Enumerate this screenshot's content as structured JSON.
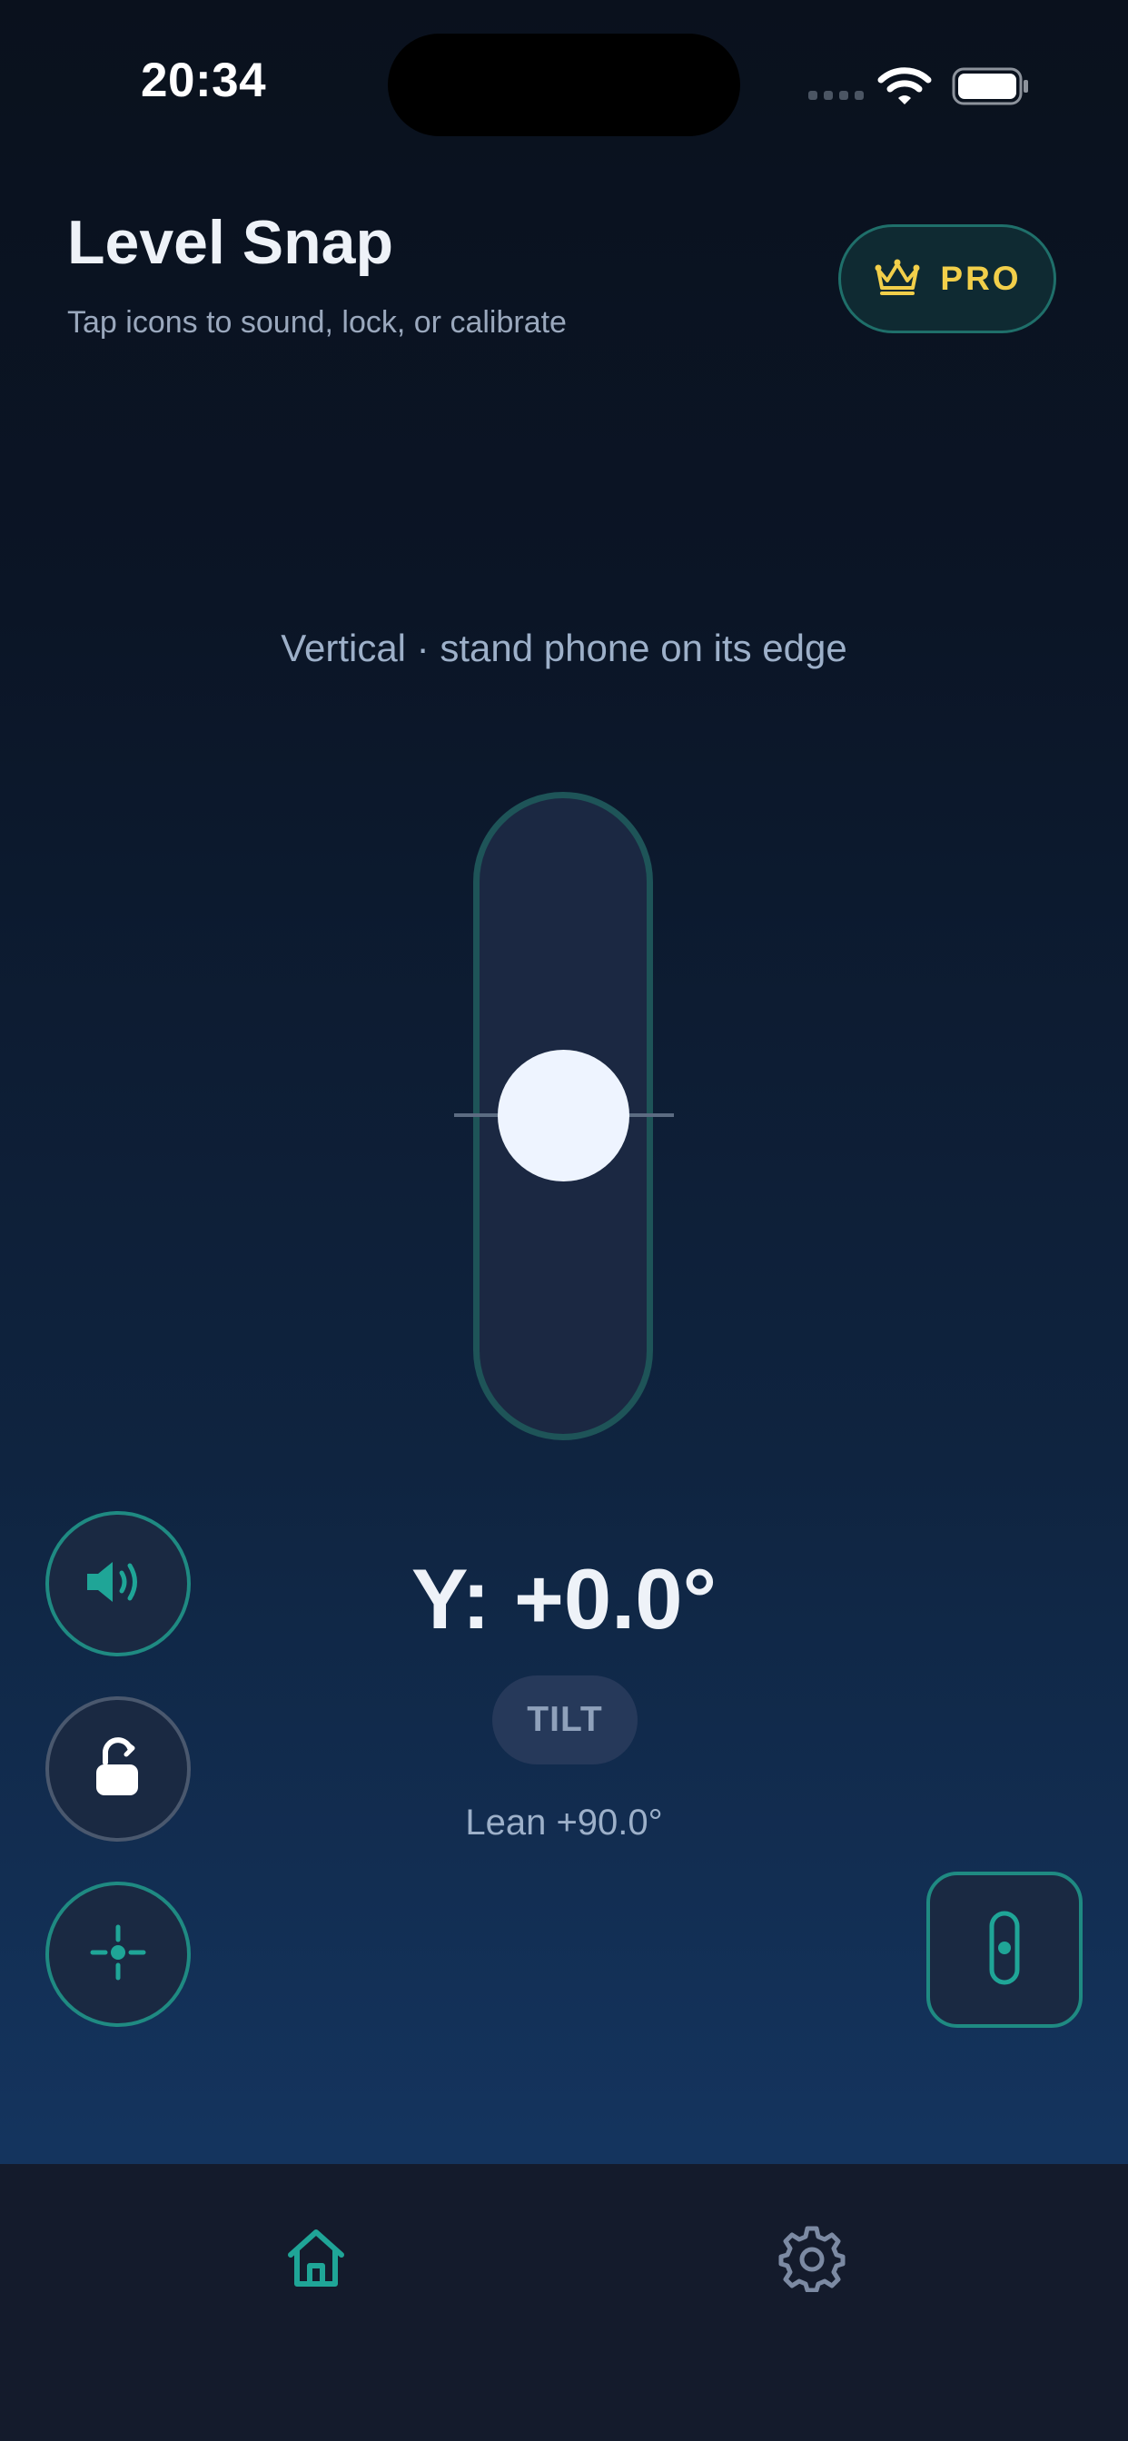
{
  "status_bar": {
    "time": "20:34"
  },
  "header": {
    "title": "Level Snap",
    "subtitle": "Tap icons to sound, lock, or calibrate",
    "pro_label": "PRO",
    "pro_icon": "crown-icon"
  },
  "level": {
    "orientation_hint": "Vertical · stand phone on its edge",
    "angle_readout": "Y: +0.0°",
    "mode_badge": "TILT",
    "lean_readout": "Lean +90.0°",
    "bubble_offset": 0
  },
  "controls": {
    "sound_icon": "speaker-icon",
    "lock_icon": "unlock-icon",
    "calibrate_icon": "crosshair-icon",
    "orientation_mode_icon": "vertical-vial-icon"
  },
  "tab_bar": {
    "items": [
      {
        "name": "home",
        "icon": "home-icon",
        "active": true
      },
      {
        "name": "settings",
        "icon": "gear-icon",
        "active": false
      }
    ]
  },
  "colors": {
    "accent_teal": "#1f8a82",
    "pro_gold": "#f2cf4a",
    "bubble": "#eef4ff",
    "tabbar_bg": "#141b2c"
  }
}
